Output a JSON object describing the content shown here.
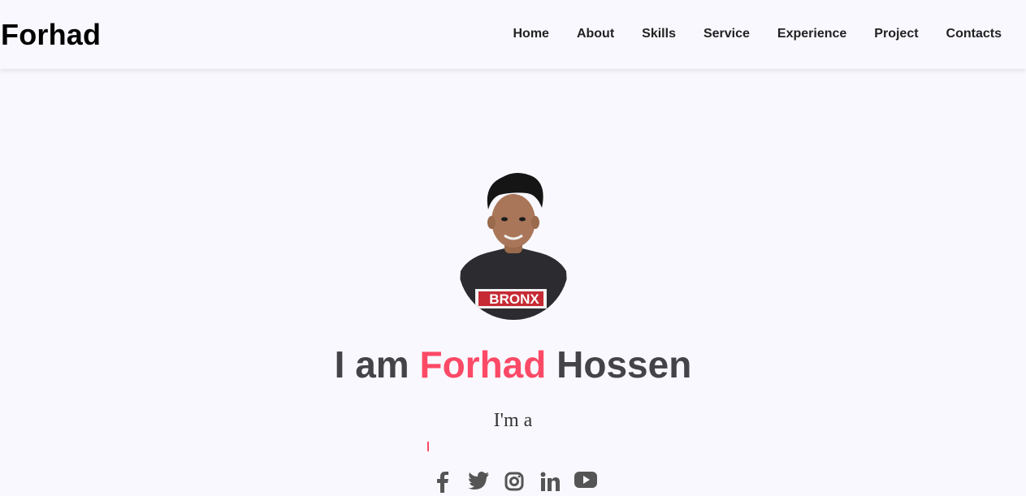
{
  "brand": "Forhad",
  "nav": {
    "home": "Home",
    "about": "About",
    "skills": "Skills",
    "service": "Service",
    "experience": "Experience",
    "project": "Project",
    "contacts": "Contacts"
  },
  "hero": {
    "title_prefix": "I am ",
    "title_name": "Forhad",
    "title_suffix": " Hossen",
    "subtitle": "I'm a",
    "shirt_text": "BRONX"
  },
  "socials": [
    "facebook-icon",
    "twitter-icon",
    "instagram-icon",
    "linkedin-icon",
    "youtube-icon"
  ],
  "colors": {
    "accent": "#fc4a66",
    "text": "#444448",
    "background": "#f9f8ff",
    "icons": "#555555"
  }
}
